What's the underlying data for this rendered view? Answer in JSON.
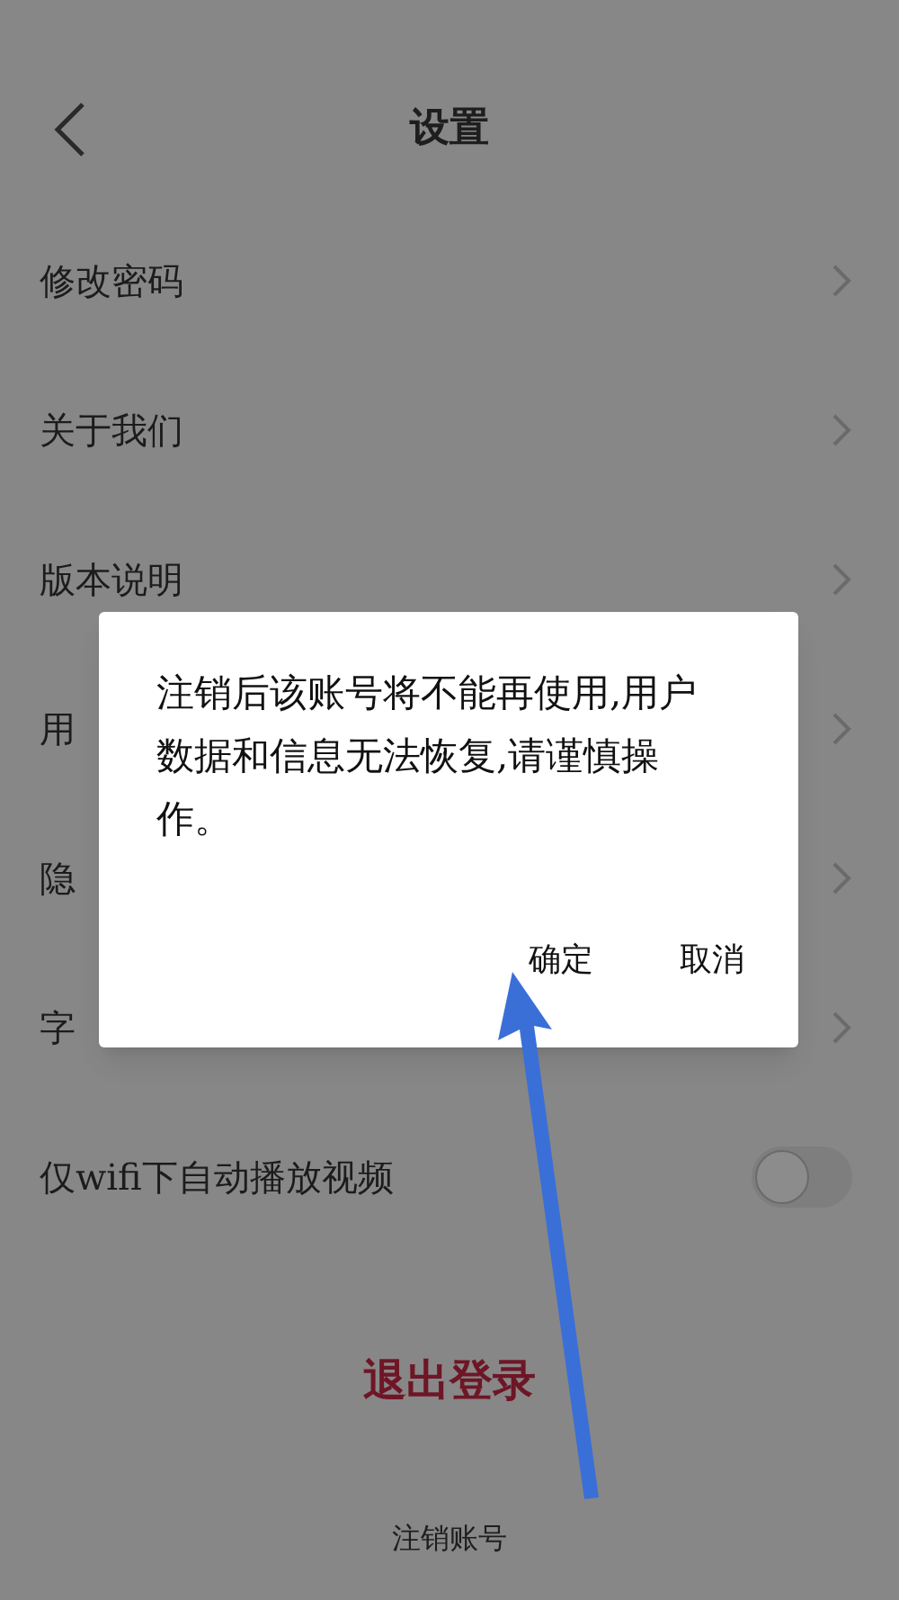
{
  "header": {
    "title": "设置"
  },
  "rows": [
    {
      "kind": "link",
      "label": "修改密码"
    },
    {
      "kind": "link",
      "label": "关于我们"
    },
    {
      "kind": "link",
      "label": "版本说明"
    },
    {
      "kind": "link",
      "label": "用"
    },
    {
      "kind": "link",
      "label": "隐"
    },
    {
      "kind": "link",
      "label": "字"
    },
    {
      "kind": "toggle",
      "label": "仅wifi下自动播放视频",
      "on": false
    }
  ],
  "logout": "退出登录",
  "delete_account": "注销账号",
  "dialog": {
    "message": "注销后该账号将不能再使用,用户数据和信息无法恢复,请谨慎操作。",
    "buttons": [
      "确定",
      "取消"
    ]
  }
}
